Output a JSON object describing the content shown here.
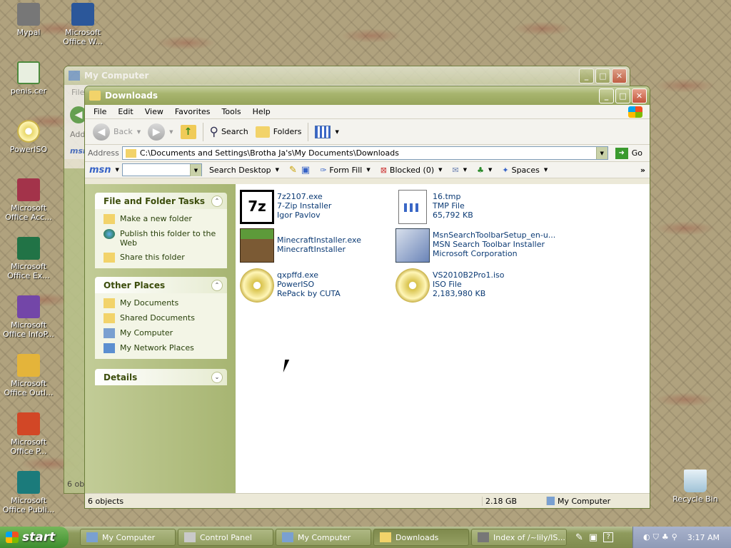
{
  "desktop": {
    "icons": [
      {
        "label": "Mypal",
        "color": "#6b6b6b"
      },
      {
        "label": "Microsoft Office W...",
        "color": "#2b579a"
      },
      {
        "label": "penis.cer",
        "color": "#4c8a3c"
      },
      {
        "label": "PowerISO",
        "color": "#d8c14a"
      },
      {
        "label": "Microsoft Office Acc...",
        "color": "#a3334a"
      },
      {
        "label": "Microsoft Office Ex...",
        "color": "#217346"
      },
      {
        "label": "Microsoft Office InfoP...",
        "color": "#7346a8"
      },
      {
        "label": "Microsoft Office Outl...",
        "color": "#e4b43a"
      },
      {
        "label": "Microsoft Office P...",
        "color": "#d24726"
      },
      {
        "label": "Microsoft Office Publi...",
        "color": "#1b7b7b"
      },
      {
        "label": "Recycle Bin",
        "color": "#cfe4f0"
      }
    ]
  },
  "bg_window": {
    "title": "My Computer",
    "menu_partial": "File",
    "addr_partial": "Add",
    "status_partial": "6 obj"
  },
  "window": {
    "title": "Downloads",
    "menu": [
      "File",
      "Edit",
      "View",
      "Favorites",
      "Tools",
      "Help"
    ],
    "toolbar": {
      "back": "Back",
      "search": "Search",
      "folders": "Folders"
    },
    "address_label": "Address",
    "address_value": "C:\\Documents and Settings\\Brotha Ja's\\My Documents\\Downloads",
    "go": "Go",
    "msn": {
      "logo": "msn",
      "search_desktop": "Search Desktop",
      "form_fill": "Form Fill",
      "blocked": "Blocked (0)",
      "spaces": "Spaces"
    },
    "tasks": {
      "title": "File and Folder Tasks",
      "items": [
        "Make a new folder",
        "Publish this folder to the Web",
        "Share this folder"
      ]
    },
    "other": {
      "title": "Other Places",
      "items": [
        "My Documents",
        "Shared Documents",
        "My Computer",
        "My Network Places"
      ]
    },
    "details": {
      "title": "Details"
    },
    "files": [
      {
        "name": "7z2107.exe",
        "line2": "7-Zip Installer",
        "line3": "Igor Pavlov",
        "icon": "7z-icon"
      },
      {
        "name": "16.tmp",
        "line2": "TMP File",
        "line3": "65,792 KB",
        "icon": "tmp-file-icon"
      },
      {
        "name": "MinecraftInstaller.exe",
        "line2": "MinecraftInstaller",
        "line3": "",
        "icon": "minecraft-icon"
      },
      {
        "name": "MsnSearchToolbarSetup_en-u...",
        "line2": "MSN Search Toolbar Installer",
        "line3": "Microsoft Corporation",
        "icon": "installer-icon"
      },
      {
        "name": "qxpffd.exe",
        "line2": "PowerISO",
        "line3": "RePack by CUTA",
        "icon": "disc-icon"
      },
      {
        "name": "VS2010B2Pro1.iso",
        "line2": "ISO File",
        "line3": "2,183,980 KB",
        "icon": "disc-icon"
      }
    ],
    "status": {
      "count": "6 objects",
      "size": "2.18 GB",
      "location": "My Computer"
    }
  },
  "taskbar": {
    "start": "start",
    "items": [
      "My Computer",
      "Control Panel",
      "My Computer",
      "Downloads",
      "Index of /~lily/IS..."
    ],
    "clock": "3:17 AM"
  }
}
